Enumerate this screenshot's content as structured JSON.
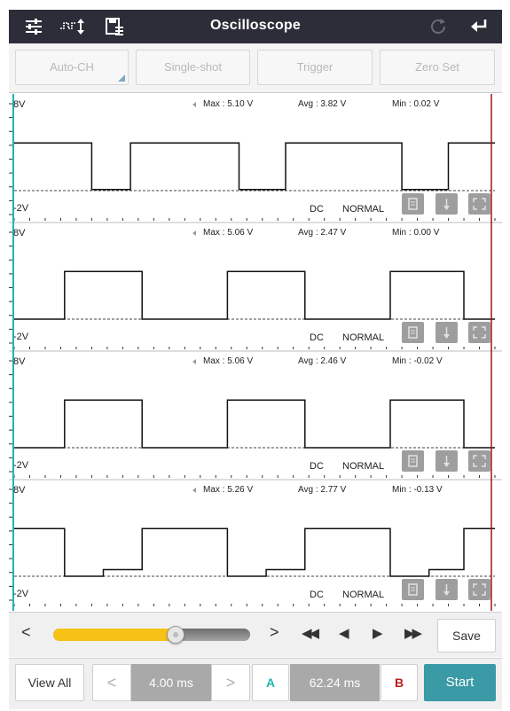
{
  "header": {
    "title": "Oscilloscope",
    "icons": [
      "sliders-icon",
      "pulse-trigger-icon",
      "save-file-icon",
      "refresh-icon",
      "back-icon"
    ]
  },
  "toolbar": {
    "buttons": [
      "Auto-CH",
      "Single-shot",
      "Trigger",
      "Zero Set"
    ]
  },
  "channels": [
    {
      "top": "8V",
      "bottom": "-2V",
      "max": "Max : 5.10 V",
      "avg": "Avg : 3.82 V",
      "min": "Min : 0.02 V",
      "coupling": "DC",
      "mode": "NORMAL",
      "waveform": [
        [
          0,
          4.3
        ],
        [
          1.0,
          4.3
        ],
        [
          1.0,
          0.1
        ],
        [
          1.5,
          0.1
        ],
        [
          1.5,
          4.3
        ],
        [
          2.9,
          4.3
        ],
        [
          2.9,
          0.1
        ],
        [
          3.5,
          0.1
        ],
        [
          3.5,
          4.3
        ],
        [
          5.0,
          4.3
        ],
        [
          5.0,
          0.1
        ],
        [
          5.6,
          0.1
        ],
        [
          5.6,
          4.3
        ],
        [
          6.2,
          4.3
        ]
      ]
    },
    {
      "top": "8V",
      "bottom": "-2V",
      "max": "Max : 5.06 V",
      "avg": "Avg : 2.47 V",
      "min": "Min : 0.00 V",
      "coupling": "DC",
      "mode": "NORMAL",
      "waveform": [
        [
          0,
          0
        ],
        [
          0.65,
          0
        ],
        [
          0.65,
          4.3
        ],
        [
          1.65,
          4.3
        ],
        [
          1.65,
          0
        ],
        [
          2.75,
          0
        ],
        [
          2.75,
          4.3
        ],
        [
          3.75,
          4.3
        ],
        [
          3.75,
          0
        ],
        [
          4.85,
          0
        ],
        [
          4.85,
          4.3
        ],
        [
          5.8,
          4.3
        ],
        [
          5.8,
          0
        ],
        [
          6.2,
          0
        ]
      ]
    },
    {
      "top": "8V",
      "bottom": "-2V",
      "max": "Max : 5.06 V",
      "avg": "Avg : 2.46 V",
      "min": "Min : -0.02 V",
      "coupling": "DC",
      "mode": "NORMAL",
      "waveform": [
        [
          0,
          0
        ],
        [
          0.65,
          0
        ],
        [
          0.65,
          4.3
        ],
        [
          1.65,
          4.3
        ],
        [
          1.65,
          0
        ],
        [
          2.75,
          0
        ],
        [
          2.75,
          4.3
        ],
        [
          3.75,
          4.3
        ],
        [
          3.75,
          0
        ],
        [
          4.85,
          0
        ],
        [
          4.85,
          4.3
        ],
        [
          5.8,
          4.3
        ],
        [
          5.8,
          0
        ],
        [
          6.2,
          0
        ]
      ]
    },
    {
      "top": "8V",
      "bottom": "-2V",
      "max": "Max : 5.26 V",
      "avg": "Avg : 2.77 V",
      "min": "Min : -0.13 V",
      "coupling": "DC",
      "mode": "NORMAL",
      "waveform": [
        [
          0,
          4.3
        ],
        [
          0.65,
          4.3
        ],
        [
          0.65,
          0
        ],
        [
          1.15,
          0
        ],
        [
          1.15,
          0.6
        ],
        [
          1.65,
          0.6
        ],
        [
          1.65,
          4.3
        ],
        [
          2.75,
          4.3
        ],
        [
          2.75,
          0
        ],
        [
          3.25,
          0
        ],
        [
          3.25,
          0.6
        ],
        [
          3.75,
          0.6
        ],
        [
          3.75,
          4.3
        ],
        [
          4.85,
          4.3
        ],
        [
          4.85,
          0
        ],
        [
          5.35,
          0
        ],
        [
          5.35,
          0.6
        ],
        [
          5.8,
          0.6
        ],
        [
          5.8,
          4.3
        ],
        [
          6.2,
          4.3
        ]
      ]
    }
  ],
  "playback": {
    "slider_value": 0.62,
    "prev": "<",
    "next": ">",
    "fast_back": "◀◀",
    "step_back": "◀",
    "step_fwd": "▶",
    "fast_fwd": "▶▶",
    "save_label": "Save"
  },
  "bottom": {
    "view_all": "View All",
    "prev": "<",
    "time_per_div": "4.00 ms",
    "next": ">",
    "cursor_a": "A",
    "cursor_delta": "62.24 ms",
    "cursor_b": "B",
    "start_label": "Start"
  },
  "colors": {
    "header_bg": "#2c2d38",
    "cursor_a": "#1fb6b0",
    "cursor_b": "#a01515",
    "slider_fill": "#f7c216",
    "start_bg": "#3a9aa5"
  }
}
